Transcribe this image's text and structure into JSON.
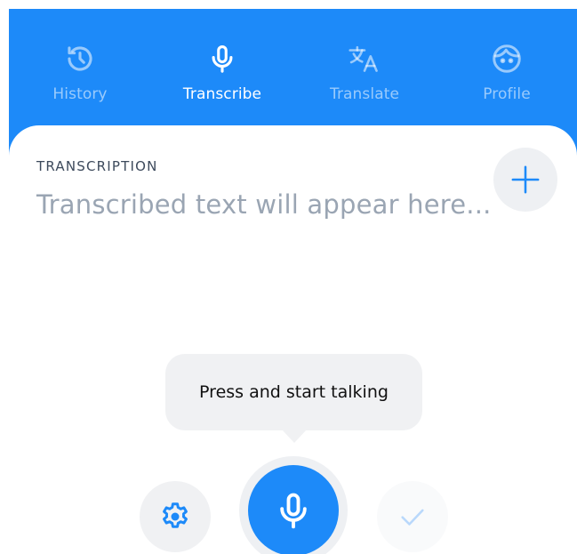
{
  "nav": {
    "items": [
      {
        "label": "History",
        "icon": "history-icon",
        "active": false
      },
      {
        "label": "Transcribe",
        "icon": "microphone-icon",
        "active": true
      },
      {
        "label": "Translate",
        "icon": "translate-icon",
        "active": false
      },
      {
        "label": "Profile",
        "icon": "face-icon",
        "active": false
      }
    ]
  },
  "transcription": {
    "section_label": "TRANSCRIPTION",
    "placeholder": "Transcribed text will appear here...",
    "add_icon": "plus-icon"
  },
  "controls": {
    "tooltip": "Press and start talking",
    "settings_icon": "gear-icon",
    "record_icon": "microphone-icon",
    "confirm_icon": "check-icon"
  },
  "colors": {
    "accent": "#1d8af9",
    "placeholder": "#9aa5b3",
    "label": "#3d4a5c"
  }
}
